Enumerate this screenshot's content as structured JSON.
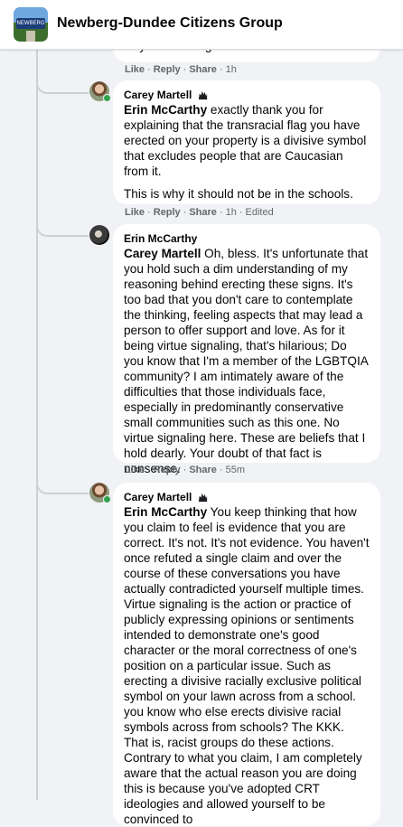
{
  "header": {
    "group_name": "Newberg-Dundee Citizens Group",
    "group_logo_text": "NEWBERG"
  },
  "comments": [
    {
      "continued_text": "way to virtue signal.",
      "actions": {
        "like": "Like",
        "reply": "Reply",
        "share": "Share",
        "time": "1h"
      }
    },
    {
      "author": "Carey Martell",
      "mention": "Erin McCarthy",
      "paragraphs": [
        " exactly thank you for explaining that the transracial flag you have erected on your property is a divisive symbol that excludes people that are Caucasian from it.",
        "This is why it should not be in the schools."
      ],
      "actions": {
        "like": "Like",
        "reply": "Reply",
        "share": "Share",
        "time": "1h",
        "edited": "Edited"
      }
    },
    {
      "author": "Erin McCarthy",
      "mention": "Carey Martell",
      "paragraphs": [
        " Oh, bless. It's unfortunate that you hold such a dim understanding of my reasoning behind erecting these signs. It's too bad that you don't care to contemplate the thinking, feeling aspects that may lead a person to offer support and love. As for it being virtue signaling, that's hilarious; Do you know that I'm a member of the LGBTQIA community? I am intimately aware of the difficulties that those individuals face, especially in predominantly conservative small communities such as this one. No virtue signaling here. These are beliefs that I hold dearly. Your doubt of that fact is nonsense."
      ],
      "actions": {
        "like": "Like",
        "reply": "Reply",
        "share": "Share",
        "time": "55m"
      }
    },
    {
      "author": "Carey Martell",
      "mention": "Erin McCarthy",
      "paragraphs": [
        " You keep thinking that how you claim to feel is evidence that you are correct. It's not. It's not evidence. You haven't once refuted a single claim and over the course of these conversations you have actually contradicted yourself multiple times. Virtue signaling is the action or practice of publicly expressing opinions or sentiments intended to demonstrate one's good character or the moral correctness of one's position on a particular issue. Such as erecting a divisive racially exclusive political symbol on your lawn across from a school. you know who else erects divisive racial symbols across from schools? The KKK. That is, racist groups do these actions. Contrary to what you claim, I am completely aware that the actual reason you are doing this is because you've adopted CRT ideologies and allowed yourself to be convinced to"
      ]
    }
  ],
  "colors": {
    "bubble": "#ffffff",
    "page": "#f0f2f5",
    "online": "#31a24c",
    "meta": "#65676b"
  }
}
